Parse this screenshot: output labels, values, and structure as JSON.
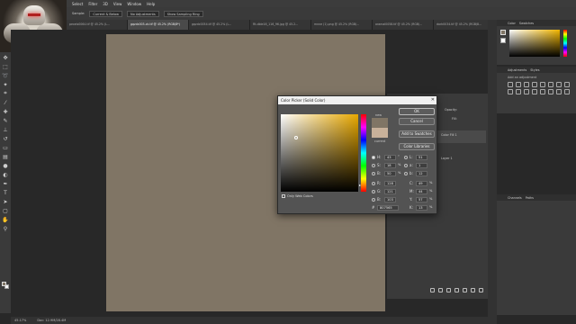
{
  "menu": [
    "Select",
    "Filter",
    "3D",
    "View",
    "Window",
    "Help"
  ],
  "options": {
    "sample_label": "Sample:",
    "sample_value": "Current & Below",
    "no_adjust": "No Adjustments",
    "show_ring": "Show Sampling Ring"
  },
  "tabs": [
    {
      "label": "pexels0064.tif @ 45.2% (L..."
    },
    {
      "label": "gqzdc003-ck.tif @ 45.2% (RGB/8*)"
    },
    {
      "label": "gqzdc0054.tif @ 45.2% (L..."
    },
    {
      "label": "Rt-dble16_116_96.jpg @ 45.2..."
    },
    {
      "label": "mnne (1).png @ 45.2% (RGB/..."
    },
    {
      "label": "aramal0058.tif @ 45.2% (RGB/..."
    },
    {
      "label": "dark0034.tif @ 45.2% (RGB/8..."
    }
  ],
  "status": {
    "zoom": "45.17%",
    "doc": "Doc: 12.9M/28.4M"
  },
  "colors": {
    "canvas": "#807565",
    "current": "#c8b19a",
    "hue_accent": "#e8a800"
  },
  "tools": [
    "move-icon",
    "marquee-icon",
    "lasso-icon",
    "wand-icon",
    "crop-icon",
    "eyedropper-icon",
    "heal-icon",
    "brush-icon",
    "stamp-icon",
    "history-brush-icon",
    "eraser-icon",
    "gradient-icon",
    "blur-icon",
    "dodge-icon",
    "pen-icon",
    "type-icon",
    "path-select-icon",
    "shape-icon",
    "hand-icon",
    "zoom-icon"
  ],
  "panels": {
    "color_tab": "Color",
    "swatches_tab": "Swatches",
    "adjustments_tab": "Adjustments",
    "styles_tab": "Styles",
    "add_adjustment": "Add an adjustment",
    "channels_tab": "Channels",
    "paths_tab": "Paths",
    "opacity_label": "Opacity:",
    "fill_label": "Fill:",
    "layer1": "Color Fill 1",
    "layer2": "Layer 1"
  },
  "dialog": {
    "title": "Color Picker (Solid Color)",
    "ok": "OK",
    "cancel": "Cancel",
    "add_to_swatches": "Add to Swatches",
    "color_libraries": "Color Libraries",
    "new_label": "new",
    "current_label": "current",
    "only_web": "Only Web Colors",
    "H": "43",
    "S": "18",
    "B": "50",
    "R": "128",
    "G": "121",
    "Bv": "103",
    "L": "51",
    "a": "1",
    "b": "12",
    "C": "49",
    "M": "44",
    "Y": "57",
    "K": "13",
    "hex": "807565",
    "deg": "°",
    "pct": "%"
  }
}
